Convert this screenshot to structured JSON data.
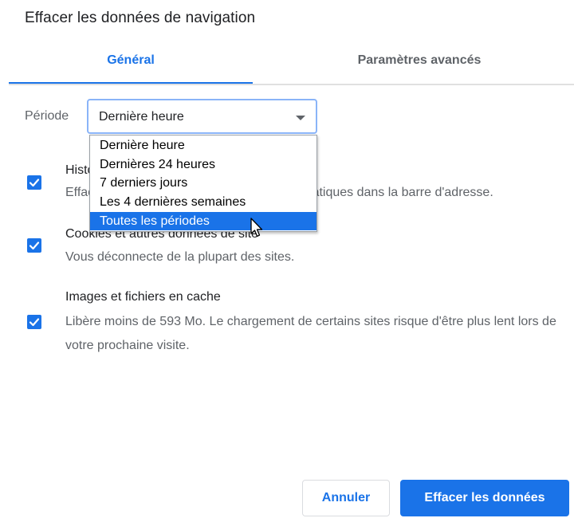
{
  "dialog": {
    "title": "Effacer les données de navigation"
  },
  "tabs": [
    {
      "label": "Général",
      "active": true
    },
    {
      "label": "Paramètres avancés",
      "active": false
    }
  ],
  "period": {
    "label": "Période",
    "selected": "Dernière heure",
    "dropdown_open": true,
    "options": [
      "Dernière heure",
      "Dernières 24 heures",
      "7 derniers jours",
      "Les 4 dernières semaines",
      "Toutes les périodes"
    ],
    "highlighted_index": 4
  },
  "options": [
    {
      "title": "Historique de navigation",
      "description": "Efface l'historique et les saisies semi-automatiques dans la barre d'adresse.",
      "checked": true
    },
    {
      "title": "Cookies et autres données de site",
      "description": "Vous déconnecte de la plupart des sites.",
      "checked": true
    },
    {
      "title": "Images et fichiers en cache",
      "description": "Libère moins de 593 Mo. Le chargement de certains sites risque d'être plus lent lors de votre prochaine visite.",
      "checked": true
    }
  ],
  "buttons": {
    "cancel": "Annuler",
    "clear": "Effacer les données"
  },
  "colors": {
    "accent": "#1a73e8",
    "text": "#202124",
    "secondary_text": "#5f6368"
  },
  "icons": {
    "checkbox": "check-icon",
    "dropdown": "chevron-down-icon",
    "cursor": "mouse-pointer-icon"
  }
}
